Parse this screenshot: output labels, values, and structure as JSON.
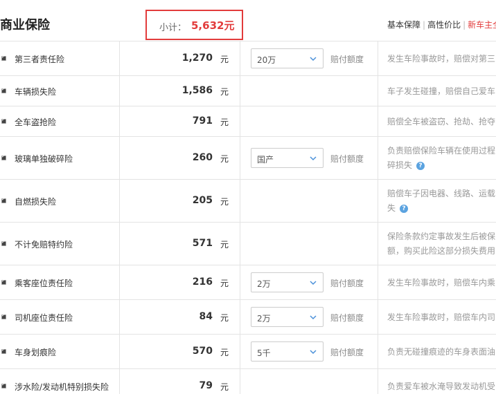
{
  "header": {
    "title": "商业保险",
    "subtotal_label": "小计：",
    "subtotal_value": "5,632元",
    "plans": [
      "基本保障",
      "高性价比",
      "新车主全"
    ]
  },
  "rows": [
    {
      "name": "第三者责任险",
      "price": "1,270",
      "unit": "元",
      "select": "20万",
      "amount_label": "赔付额度",
      "desc": [
        "发生车险事故时，赔偿对第三"
      ],
      "help": false
    },
    {
      "name": "车辆损失险",
      "price": "1,586",
      "unit": "元",
      "select": null,
      "amount_label": null,
      "desc": [
        "车子发生碰撞，赔偿自己爱车"
      ],
      "help": false
    },
    {
      "name": "全车盗抢险",
      "price": "791",
      "unit": "元",
      "select": null,
      "amount_label": null,
      "desc": [
        "赔偿全车被盗窃、抢劫、抢夺"
      ],
      "help": false
    },
    {
      "name": "玻璃单独破碎险",
      "price": "260",
      "unit": "元",
      "select": "国产",
      "amount_label": "赔付额度",
      "desc": [
        "负责赔偿保险车辆在使用过程",
        "碎损失"
      ],
      "help": true
    },
    {
      "name": "自燃损失险",
      "price": "205",
      "unit": "元",
      "select": null,
      "amount_label": null,
      "desc": [
        "赔偿车子因电器、线路、运载",
        "失"
      ],
      "help": true
    },
    {
      "name": "不计免赔特约险",
      "price": "571",
      "unit": "元",
      "select": null,
      "amount_label": null,
      "desc": [
        "保险条款约定事故发生后被保",
        "额，购买此险这部分损失费用"
      ],
      "help": false
    },
    {
      "name": "乘客座位责任险",
      "price": "216",
      "unit": "元",
      "select": "2万",
      "amount_label": "赔付额度",
      "desc": [
        "发生车险事故时，赔偿车内乘"
      ],
      "help": false
    },
    {
      "name": "司机座位责任险",
      "price": "84",
      "unit": "元",
      "select": "2万",
      "amount_label": "赔付额度",
      "desc": [
        "发生车险事故时，赔偿车内司"
      ],
      "help": false
    },
    {
      "name": "车身划痕险",
      "price": "570",
      "unit": "元",
      "select": "5千",
      "amount_label": "赔付额度",
      "desc": [
        "负责无碰撞痕迹的车身表面油"
      ],
      "help": false
    },
    {
      "name": "涉水险/发动机特别损失险",
      "price": "79",
      "unit": "元",
      "select": null,
      "amount_label": null,
      "desc": [
        "负责爱车被水淹导致发动机受"
      ],
      "help": false
    }
  ],
  "icons": {
    "checkbox": "checkbox-checked-icon",
    "chevron": "chevron-down-icon",
    "help": "question-help-icon"
  },
  "colors": {
    "accent_red": "#e23b3b",
    "help_blue": "#5ba3e0",
    "border": "#e3e3e3"
  }
}
